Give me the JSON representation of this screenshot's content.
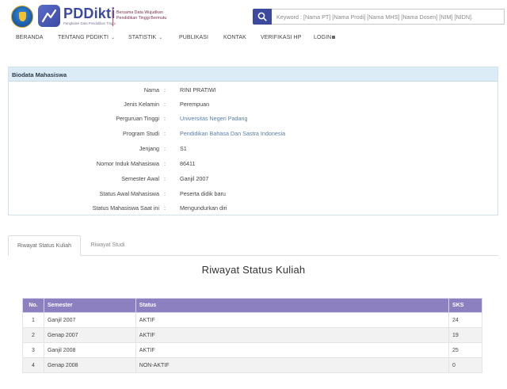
{
  "header": {
    "brand": "PDDikti",
    "brand_sub": "Pangkalan Data Pendidikan Tinggi",
    "tagline_line1": "Bersama Data Wujudkan",
    "tagline_line2": "Pendidikan Tinggi Bermutu",
    "search_placeholder": "Keyword : [Nama PT] [Nama Prodi] [Nama MHS] [Nama Dosen] [NIM] [NIDN].",
    "brand_color": "#3b4a9e"
  },
  "nav": {
    "items": [
      {
        "label": "BERANDA"
      },
      {
        "label": "TENTANG PDDIKTI"
      },
      {
        "label": "STATISTIK"
      },
      {
        "label": "PUBLIKASI"
      },
      {
        "label": "KONTAK"
      },
      {
        "label": "VERIFIKASI HP"
      },
      {
        "label": "LOGIN"
      }
    ]
  },
  "biodata": {
    "title": "Biodata Mahasiswa",
    "separator": ":",
    "rows": [
      {
        "label": "Nama",
        "value": "RINI PRATIWI"
      },
      {
        "label": "Jenis Kelamin",
        "value": "Perempuan"
      },
      {
        "label": "Perguruan Tinggi",
        "value": "Universitas Negeri Padang"
      },
      {
        "label": "Program Studi",
        "value": "Pendidikan Bahasa Dan Sastra Indonesia"
      },
      {
        "label": "Jenjang",
        "value": "S1"
      },
      {
        "label": "Nomor Induk Mahasiswa",
        "value": "86411"
      },
      {
        "label": "Semester Awal",
        "value": "Ganjil 2007"
      },
      {
        "label": "Status Awal Mahasiswa",
        "value": "Peserta didik baru"
      },
      {
        "label": "Status Mahasiswa Saat ini",
        "value": "Mengundurkan diri"
      }
    ]
  },
  "tabs": [
    {
      "label": "Riwayat Status Kuliah"
    },
    {
      "label": "Riwayat Studi"
    }
  ],
  "section_title": "Riwayat Status Kuliah",
  "table": {
    "headers": [
      "No.",
      "Semester",
      "Status",
      "SKS"
    ],
    "rows": [
      [
        "1",
        "Ganjil 2007",
        "AKTIF",
        "24"
      ],
      [
        "2",
        "Genap 2007",
        "AKTIF",
        "19"
      ],
      [
        "3",
        "Ganjil 2008",
        "AKTIF",
        "25"
      ],
      [
        "4",
        "Genap 2008",
        "NON-AKTIF",
        "0"
      ]
    ],
    "header_color": "#8c80c0"
  }
}
